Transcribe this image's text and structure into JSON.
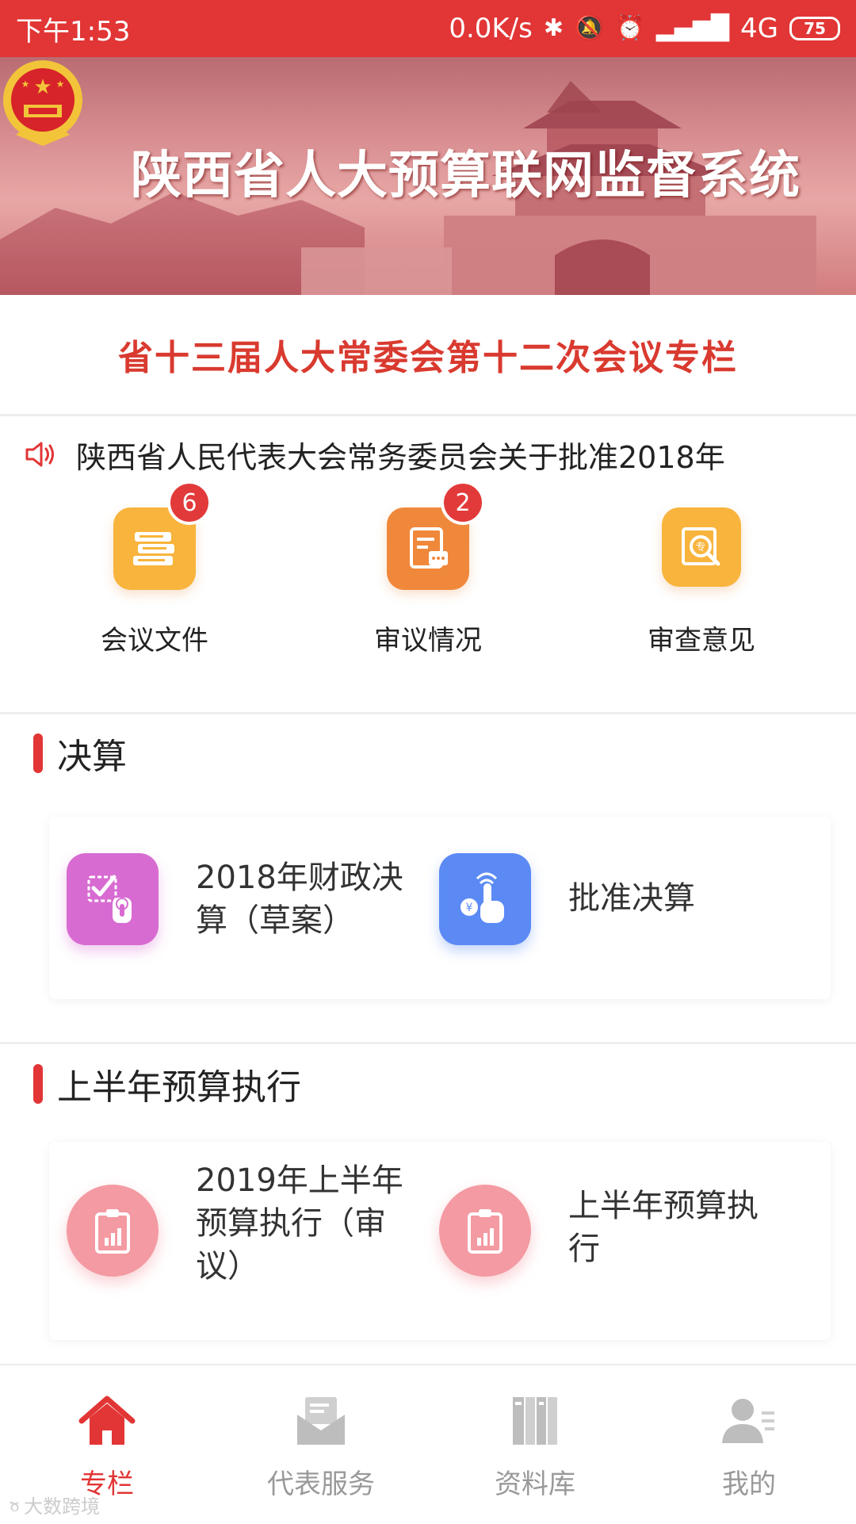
{
  "status_bar": {
    "time": "下午1:53",
    "net_speed": "0.0K/s",
    "signal": "4G",
    "battery": "75"
  },
  "banner": {
    "title": "陕西省人大预算联网监督系统"
  },
  "subtitle": "省十三届人大常委会第十二次会议专栏",
  "notice": {
    "text": "陕西省人民代表大会常务委员会关于批准2018年"
  },
  "quick_entries": [
    {
      "label": "会议文件",
      "badge": "6",
      "icon": "books-icon",
      "color": "#f8b43c"
    },
    {
      "label": "审议情况",
      "badge": "2",
      "icon": "document-comment-icon",
      "color": "#f0883c"
    },
    {
      "label": "审查意见",
      "badge": "",
      "icon": "magnify-document-icon",
      "color": "#f8b43c"
    }
  ],
  "sections": [
    {
      "title": "决算",
      "items": [
        {
          "label": "2018年财政决算（草案）",
          "icon": "check-touch-icon",
          "color": "#d86bd2"
        },
        {
          "label": "批准决算",
          "icon": "yuan-touch-icon",
          "color": "#5b8af4"
        }
      ]
    },
    {
      "title": "上半年预算执行",
      "items": [
        {
          "label": "2019年上半年预算执行（审议）",
          "icon": "clipboard-chart-icon",
          "color": "#f49aa2"
        },
        {
          "label": "上半年预算执行",
          "icon": "clipboard-chart-icon",
          "color": "#f49aa2"
        }
      ]
    }
  ],
  "bottom_nav": [
    {
      "label": "专栏",
      "icon": "home-icon",
      "active": true
    },
    {
      "label": "代表服务",
      "icon": "envelope-icon",
      "active": false
    },
    {
      "label": "资料库",
      "icon": "bookshelf-icon",
      "active": false
    },
    {
      "label": "我的",
      "icon": "user-icon",
      "active": false
    }
  ],
  "colors": {
    "primary": "#e23535",
    "subtitle": "#d93a2f"
  },
  "watermark": "大数跨境"
}
